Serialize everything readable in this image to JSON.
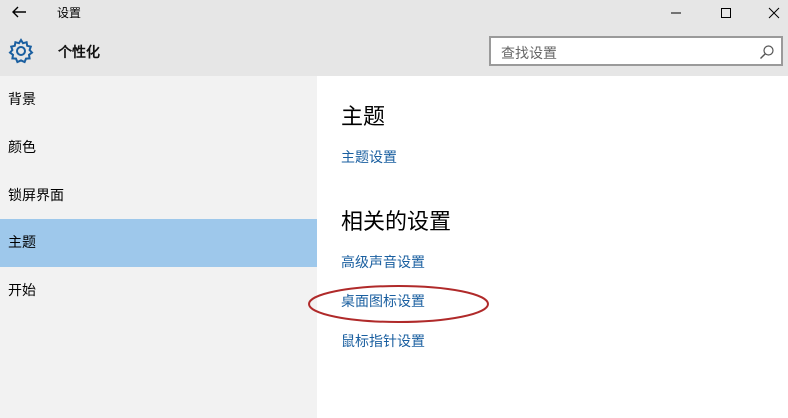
{
  "window": {
    "title": "设置",
    "back_icon": "back-arrow-icon",
    "controls": [
      "minimize-icon",
      "maximize-icon",
      "close-icon"
    ]
  },
  "header": {
    "icon": "gear-icon",
    "title": "个性化",
    "search_placeholder": "查找设置",
    "search_icon": "search-icon"
  },
  "sidebar": {
    "items": [
      {
        "label": "背景",
        "selected": false
      },
      {
        "label": "颜色",
        "selected": false
      },
      {
        "label": "锁屏界面",
        "selected": false
      },
      {
        "label": "主题",
        "selected": true
      },
      {
        "label": "开始",
        "selected": false
      }
    ]
  },
  "main": {
    "theme_heading": "主题",
    "theme_settings_link": "主题设置",
    "related_heading": "相关的设置",
    "related_links": [
      "高级声音设置",
      "桌面图标设置",
      "鼠标指针设置"
    ],
    "highlighted_link_index": 1
  },
  "colors": {
    "accent": "#1a5fa0",
    "selected_nav": "#9ec8eb",
    "annotation": "#b02a2a",
    "chrome": "#e6e6e6",
    "sidebar": "#f2f2f2"
  }
}
